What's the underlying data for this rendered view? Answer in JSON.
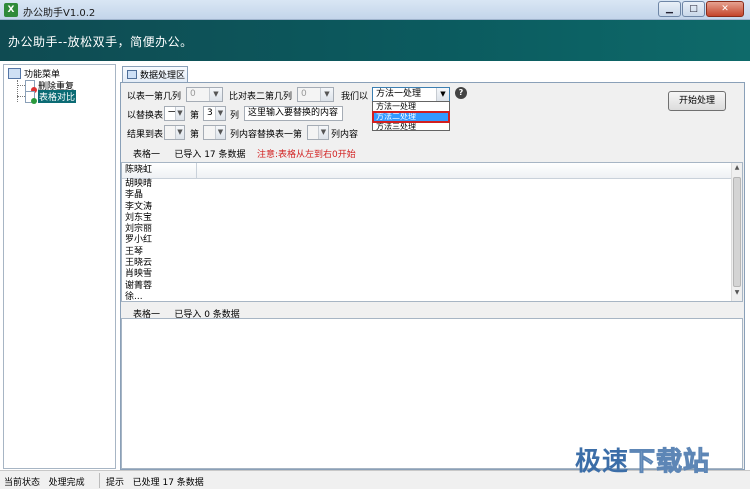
{
  "window": {
    "title": "办公助手V1.0.2",
    "icon": "excel-app-icon"
  },
  "banner": {
    "text": "办公助手--放松双手，简便办公。"
  },
  "tree": {
    "root": "功能菜单",
    "items": [
      {
        "label": "删除重复",
        "icon": "doc-red-icon"
      },
      {
        "label": "表格对比",
        "icon": "doc-green-icon",
        "selected": true
      }
    ]
  },
  "tab": {
    "label": "数据处理区"
  },
  "form": {
    "col1_label": "以表一第几列",
    "col1_value": "0",
    "col2_label": "比对表二第几列",
    "col2_value": "0",
    "method_label": "我们以",
    "method_value": "方法一处理",
    "method_options": [
      "方法一处理",
      "方法二处理",
      "方法三处理"
    ],
    "method_highlighted": "方法二处理",
    "replace_label": "以替换表",
    "replace_table_value": "一",
    "di_label": "第",
    "replace_col_value": "3",
    "lie_label": "列",
    "replace_text": "这里输入要替换的内容",
    "result_label": "结果到表",
    "result_table_value": "",
    "di2_label": "第",
    "result_col_value": "",
    "content_replace_label": "列内容替换表一第",
    "table1_col_value": "",
    "col_content_label": "列内容",
    "start_button": "开始处理"
  },
  "table1": {
    "name": "表格一",
    "imported": "已导入 17 条数据",
    "note": "注意:表格从左到右0开始",
    "header": "陈晓虹",
    "rows": [
      "胡映晴",
      "李晶",
      "李文涛",
      "刘东宝",
      "刘宗丽",
      "罗小红",
      "王琴",
      "王晓云",
      "肖映雪",
      "谢菁蓉",
      "徐..."
    ]
  },
  "table2": {
    "name": "表格一",
    "imported": "已导入 0 条数据"
  },
  "status": {
    "state_label": "当前状态",
    "state_value": "处理完成",
    "hint_label": "提示",
    "hint_value": "已处理 17 条数据"
  },
  "watermark": {
    "text1": "极速",
    "text2": "下载站"
  }
}
